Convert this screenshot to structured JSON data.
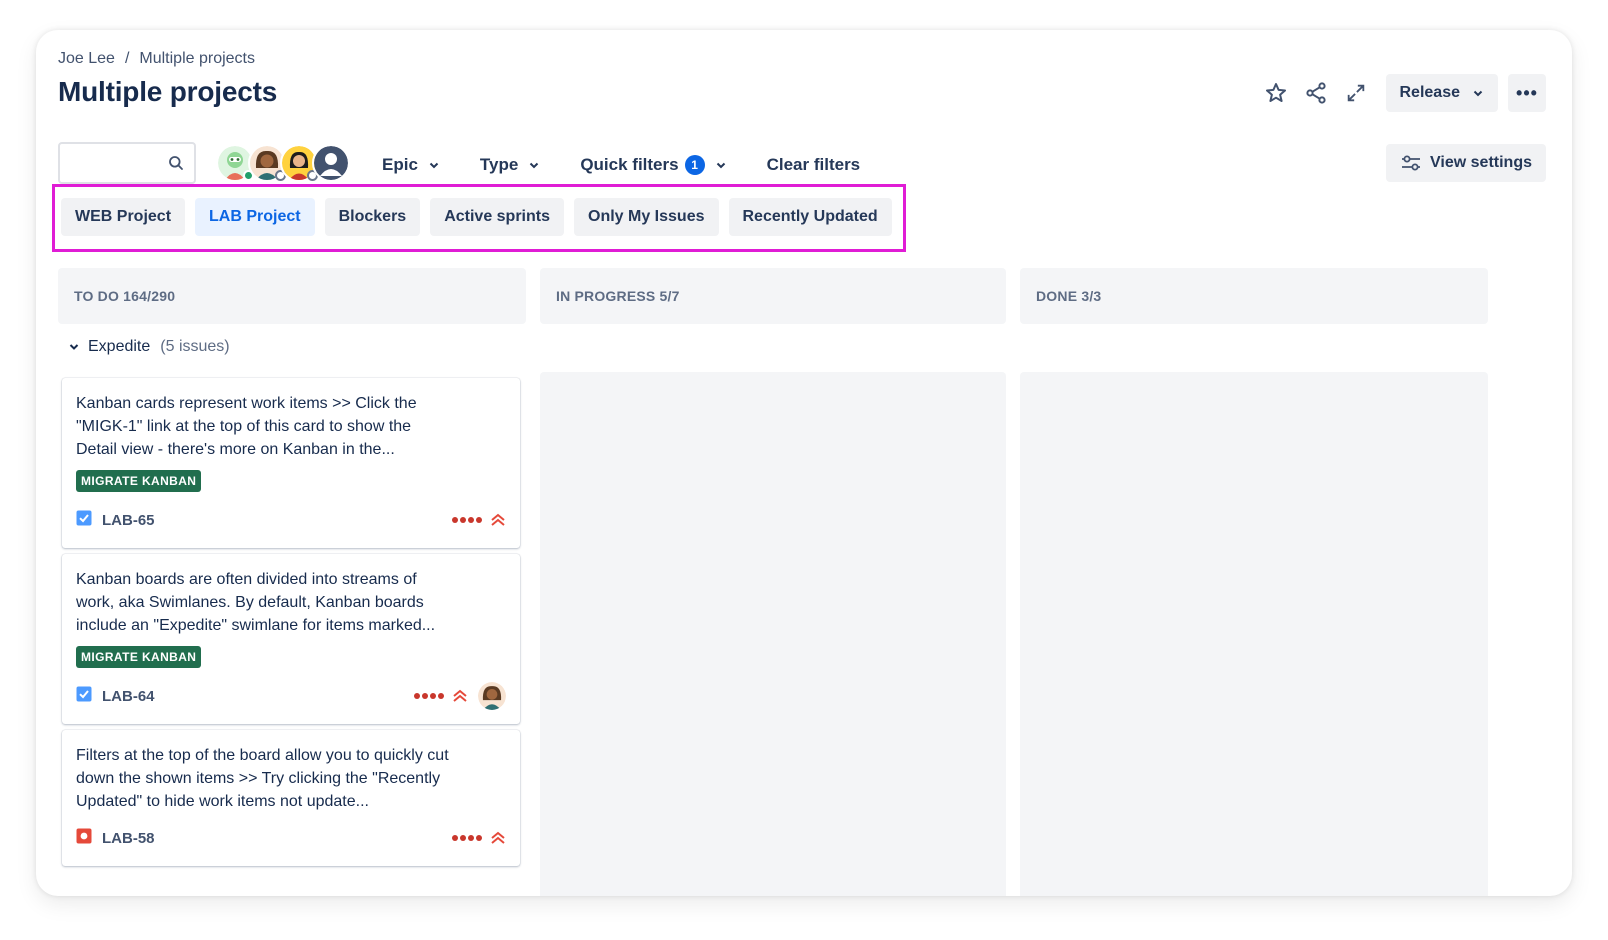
{
  "breadcrumb": {
    "owner": "Joe Lee",
    "separator": "/",
    "current": "Multiple projects"
  },
  "page_title": "Multiple projects",
  "header_actions": {
    "release_label": "Release",
    "more_label": "•••"
  },
  "toolbar": {
    "search_placeholder": "",
    "avatars": [
      "avatar-green-robot",
      "avatar-woman-brown",
      "avatar-woman-yellow",
      "avatar-default"
    ],
    "filters": {
      "epic_label": "Epic",
      "type_label": "Type",
      "quick_filters_label": "Quick filters",
      "quick_filters_count": "1",
      "clear_label": "Clear filters"
    },
    "view_settings_label": "View settings"
  },
  "quick_filter_chips": [
    {
      "label": "WEB Project",
      "active": false
    },
    {
      "label": "LAB Project",
      "active": true
    },
    {
      "label": "Blockers",
      "active": false
    },
    {
      "label": "Active sprints",
      "active": false
    },
    {
      "label": "Only My Issues",
      "active": false
    },
    {
      "label": "Recently Updated",
      "active": false
    }
  ],
  "columns": [
    {
      "title": "TO DO 164/290"
    },
    {
      "title": "IN PROGRESS 5/7"
    },
    {
      "title": "DONE 3/3"
    }
  ],
  "swimlane": {
    "name": "Expedite",
    "count": "(5 issues)"
  },
  "cards": [
    {
      "text": "Kanban cards represent work items >> Click the \"MIGK-1\" link at the top of this card to show the Detail view - there's more on Kanban in the...",
      "label": "MIGRATE KANBAN",
      "type": "task",
      "key": "LAB-65",
      "priority": "highest",
      "assignee": null
    },
    {
      "text": "Kanban boards are often divided into streams of work, aka Swimlanes. By default, Kanban boards include an \"Expedite\" swimlane for items marked...",
      "label": "MIGRATE KANBAN",
      "type": "task",
      "key": "LAB-64",
      "priority": "highest",
      "assignee": "avatar-woman-brown"
    },
    {
      "text": "Filters at the top of the board allow you to quickly cut down the shown items >> Try clicking the \"Recently Updated\" to hide work items not update...",
      "label": "",
      "type": "bug",
      "key": "LAB-58",
      "priority": "highest",
      "assignee": null
    }
  ],
  "colors": {
    "accent": "#0c66e4",
    "highlight_border": "#e01cd5",
    "label_green": "#216e4e",
    "priority_red": "#c9372c",
    "task_blue": "#4c9aff",
    "bug_red": "#e5493a"
  }
}
